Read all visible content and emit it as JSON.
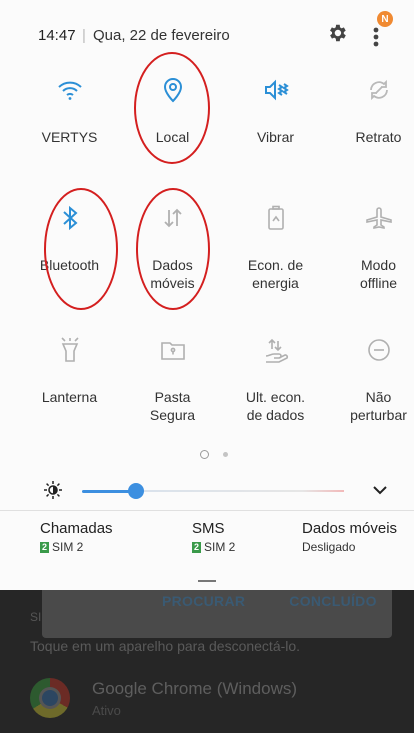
{
  "status_bar": {
    "time": "14:47",
    "separator": "|",
    "date": "Qua, 22 de fevereiro",
    "notification_badge": "N",
    "icons": [
      "gear-icon",
      "more-vert-icon"
    ]
  },
  "tiles": [
    {
      "id": "wifi",
      "label": "VERTYS",
      "icon": "wifi-icon",
      "active": true
    },
    {
      "id": "location",
      "label": "Local",
      "icon": "location-pin-icon",
      "active": true
    },
    {
      "id": "vibrate",
      "label": "Vibrar",
      "icon": "vibrate-icon",
      "active": true
    },
    {
      "id": "rotate",
      "label": "Retrato",
      "icon": "rotation-icon",
      "active": false
    },
    {
      "id": "bluetooth",
      "label": "Bluetooth",
      "icon": "bluetooth-icon",
      "active": true
    },
    {
      "id": "mobile-data",
      "label": "Dados\nmóveis",
      "icon": "data-arrows-icon",
      "active": false
    },
    {
      "id": "power-saving",
      "label": "Econ. de\nenergia",
      "icon": "battery-saver-icon",
      "active": false
    },
    {
      "id": "airplane",
      "label": "Modo\noffline",
      "icon": "airplane-icon",
      "active": false
    },
    {
      "id": "flashlight",
      "label": "Lanterna",
      "icon": "flashlight-icon",
      "active": false
    },
    {
      "id": "secure-folder",
      "label": "Pasta\nSegura",
      "icon": "secure-folder-icon",
      "active": false
    },
    {
      "id": "data-saver",
      "label": "Ult. econ.\nde dados",
      "icon": "data-saver-icon",
      "active": false
    },
    {
      "id": "dnd",
      "label": "Não\nperturbar",
      "icon": "do-not-disturb-icon",
      "active": false
    }
  ],
  "brightness": {
    "level": 0.2
  },
  "sim_info": [
    {
      "title": "Chamadas",
      "tag": "2",
      "value": "SIM 2"
    },
    {
      "title": "SMS",
      "tag": "2",
      "value": "SIM 2"
    },
    {
      "title": "Dados móveis",
      "tag": "",
      "value": "Desligado"
    }
  ],
  "background": {
    "dialog_buttons": [
      "PROCURAR",
      "CONCLUÍDO"
    ],
    "section_label": "SI",
    "hint": "Toque em um aparelho para desconectá-lo.",
    "app_name": "Google Chrome (Windows)",
    "app_status": "Ativo"
  },
  "colors": {
    "accent": "#3c8fe0",
    "highlight": "#d41f1f",
    "sim_green": "#3a9a4a",
    "badge": "#f08a32"
  }
}
